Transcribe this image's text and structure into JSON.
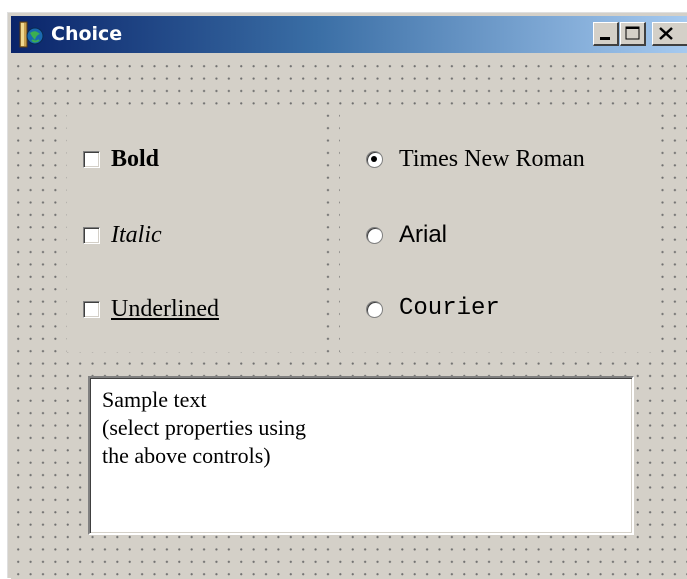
{
  "window": {
    "title": "Choice"
  },
  "title_bar": {
    "app_icon": "app-icon",
    "minimize_icon": "minimize-icon",
    "maximize_icon": "maximize-icon",
    "close_icon": "close-icon"
  },
  "style_options": [
    {
      "label": "Bold",
      "checked": false
    },
    {
      "label": "Italic",
      "checked": false
    },
    {
      "label": "Underlined",
      "checked": false
    }
  ],
  "font_options": [
    {
      "label": "Times New Roman",
      "selected": true
    },
    {
      "label": "Arial",
      "selected": false
    },
    {
      "label": "Courier",
      "selected": false
    }
  ],
  "sample": {
    "text": "Sample text\n(select properties using\nthe above controls)"
  },
  "colors": {
    "titlebar_start": "#0a246a",
    "titlebar_end": "#a6caf0",
    "face": "#d4d0c8"
  }
}
